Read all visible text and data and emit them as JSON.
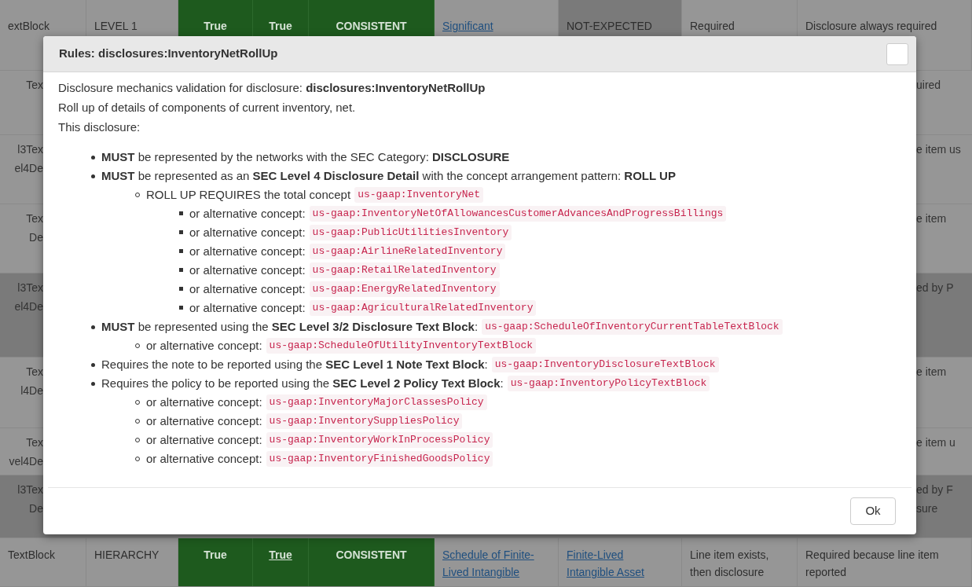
{
  "background_table": {
    "rows": [
      {
        "kind": "full",
        "shaded": false,
        "cells": [
          {
            "kind": "plain",
            "lines": [
              "extBlock"
            ]
          },
          {
            "kind": "plain",
            "lines": [
              "LEVEL 1"
            ]
          },
          {
            "kind": "green",
            "lines": [
              "True"
            ]
          },
          {
            "kind": "green",
            "lines": [
              "True"
            ]
          },
          {
            "kind": "green",
            "lines": [
              "CONSISTENT"
            ]
          },
          {
            "kind": "link",
            "lines": [
              "Significant"
            ]
          },
          {
            "kind": "shaded",
            "lines": [
              "NOT-EXPECTED"
            ]
          },
          {
            "kind": "plain",
            "lines": [
              "Required"
            ]
          },
          {
            "kind": "plain",
            "lines": [
              "Disclosure always required"
            ]
          }
        ]
      },
      {
        "kind": "edges",
        "shaded": false,
        "left": [
          "Tex"
        ],
        "right": [
          "uired"
        ]
      },
      {
        "kind": "edges",
        "shaded": false,
        "left": [
          "l3Tex",
          "el4De"
        ],
        "right": [
          "e item us"
        ]
      },
      {
        "kind": "edges",
        "shaded": false,
        "left": [
          "Tex",
          "De"
        ],
        "right": [
          "e item"
        ]
      },
      {
        "kind": "edges",
        "shaded": true,
        "left": [
          "l3Tex",
          "el4De"
        ],
        "right": [
          "ed by P"
        ]
      },
      {
        "kind": "edges",
        "shaded": false,
        "left": [
          "Tex",
          "l4De"
        ],
        "right": [
          "e item"
        ]
      },
      {
        "kind": "edges",
        "shaded": false,
        "left": [
          "Tex",
          "vel4De"
        ],
        "right": [
          "e item u"
        ]
      },
      {
        "kind": "edges",
        "shaded": true,
        "left": [
          "l3Tex",
          "De"
        ],
        "right": [
          "ed by F",
          "sure"
        ]
      },
      {
        "kind": "full",
        "shaded": false,
        "cells": [
          {
            "kind": "plain",
            "lines": [
              "TextBlock"
            ]
          },
          {
            "kind": "plain",
            "lines": [
              "HIERARCHY"
            ]
          },
          {
            "kind": "green",
            "lines": [
              "True"
            ]
          },
          {
            "kind": "green-link",
            "lines": [
              "True"
            ]
          },
          {
            "kind": "green",
            "lines": [
              "CONSISTENT"
            ]
          },
          {
            "kind": "link",
            "lines": [
              "Schedule of Finite-",
              "Lived Intangible"
            ]
          },
          {
            "kind": "link",
            "lines": [
              "Finite-Lived",
              "Intangible Asset"
            ]
          },
          {
            "kind": "plain",
            "lines": [
              "Line item exists,",
              "then disclosure"
            ]
          },
          {
            "kind": "plain",
            "lines": [
              "Required because line item",
              "reported"
            ]
          }
        ]
      }
    ]
  },
  "modal": {
    "title": "Rules: disclosures:InventoryNetRollUp",
    "intro": [
      "Disclosure mechanics validation for disclosure: **disclosures:InventoryNetRollUp**",
      "Roll up of details of components of current inventory, net.",
      "This disclosure:"
    ],
    "rules": [
      {
        "text": "**MUST** be represented by the networks with the SEC Category: **DISCLOSURE**"
      },
      {
        "text": "**MUST** be represented as an **SEC Level 4 Disclosure Detail** with the concept arrangement pattern: **ROLL UP**",
        "children": [
          {
            "text": "ROLL UP REQUIRES the total concept",
            "code": "us-gaap:InventoryNet",
            "children": [
              {
                "text": "or alternative concept:",
                "code": "us-gaap:InventoryNetOfAllowancesCustomerAdvancesAndProgressBillings"
              },
              {
                "text": "or alternative concept:",
                "code": "us-gaap:PublicUtilitiesInventory"
              },
              {
                "text": "or alternative concept:",
                "code": "us-gaap:AirlineRelatedInventory"
              },
              {
                "text": "or alternative concept:",
                "code": "us-gaap:RetailRelatedInventory"
              },
              {
                "text": "or alternative concept:",
                "code": "us-gaap:EnergyRelatedInventory"
              },
              {
                "text": "or alternative concept:",
                "code": "us-gaap:AgriculturalRelatedInventory"
              }
            ]
          }
        ]
      },
      {
        "text": "**MUST** be represented using the **SEC Level 3/2 Disclosure Text Block**:",
        "code": "us-gaap:ScheduleOfInventoryCurrentTableTextBlock",
        "children": [
          {
            "text": "or alternative concept:",
            "code": "us-gaap:ScheduleOfUtilityInventoryTextBlock"
          }
        ]
      },
      {
        "text": "Requires the note to be reported using the **SEC Level 1 Note Text Block**:",
        "code": "us-gaap:InventoryDisclosureTextBlock"
      },
      {
        "text": "Requires the policy to be reported using the **SEC Level 2 Policy Text Block**:",
        "code": "us-gaap:InventoryPolicyTextBlock",
        "children": [
          {
            "text": "or alternative concept:",
            "code": "us-gaap:InventoryMajorClassesPolicy"
          },
          {
            "text": "or alternative concept:",
            "code": "us-gaap:InventorySuppliesPolicy"
          },
          {
            "text": "or alternative concept:",
            "code": "us-gaap:InventoryWorkInProcessPolicy"
          },
          {
            "text": "or alternative concept:",
            "code": "us-gaap:InventoryFinishedGoodsPolicy"
          }
        ]
      }
    ],
    "ok_button": "Ok"
  }
}
